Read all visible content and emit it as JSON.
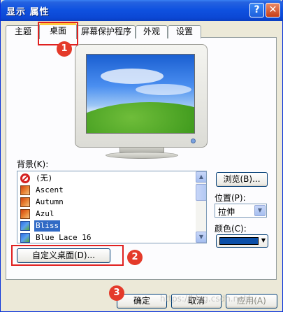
{
  "window": {
    "title": "显示 属性",
    "help_label": "?",
    "close_label": "✕"
  },
  "tabs": [
    {
      "label": "主题"
    },
    {
      "label": "桌面"
    },
    {
      "label": "屏幕保护程序"
    },
    {
      "label": "外观"
    },
    {
      "label": "设置"
    }
  ],
  "background": {
    "label": "背景(K):",
    "items": [
      {
        "label": "(无)",
        "icon": "none-icon"
      },
      {
        "label": "Ascent",
        "icon": "image-icon"
      },
      {
        "label": "Autumn",
        "icon": "image-icon"
      },
      {
        "label": "Azul",
        "icon": "image-icon"
      },
      {
        "label": "Bliss",
        "icon": "image-icon",
        "selected": true
      },
      {
        "label": "Blue Lace 16",
        "icon": "image-icon"
      }
    ]
  },
  "browse_label": "浏览(B)...",
  "position": {
    "label": "位置(P):",
    "value": "拉伸"
  },
  "color": {
    "label": "颜色(C):",
    "swatch": "#0b4fa8"
  },
  "customize_label": "自定义桌面(D)...",
  "footer": {
    "ok_label": "确定",
    "cancel_label": "取消",
    "apply_label": "应用(A)"
  },
  "annotations": [
    "1",
    "2",
    "3"
  ],
  "watermark": "https://blog.csdn.net/..."
}
